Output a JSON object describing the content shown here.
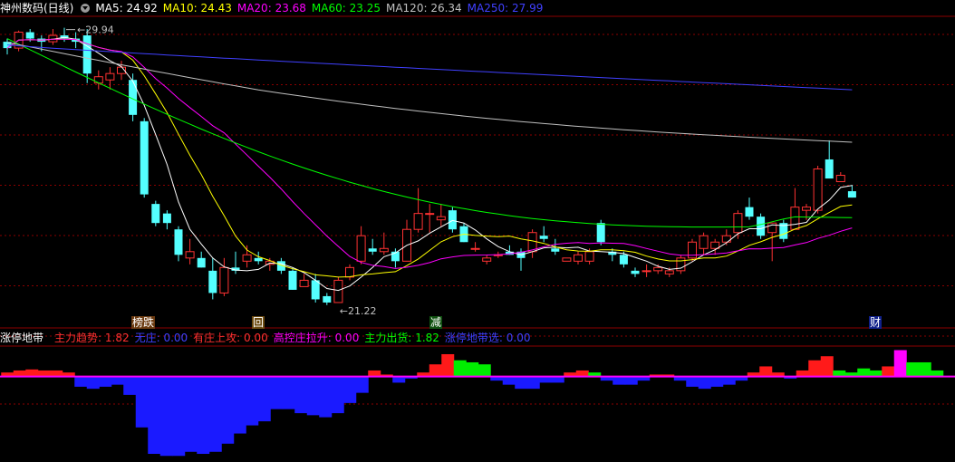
{
  "main_legend": {
    "title": "神州数码(日线)",
    "items": [
      {
        "label": "MA5: ",
        "value": "24.92",
        "color": "#ffffff"
      },
      {
        "label": "MA10: ",
        "value": "24.43",
        "color": "#ffff00"
      },
      {
        "label": "MA20: ",
        "value": "23.68",
        "color": "#ff00ff"
      },
      {
        "label": "MA60: ",
        "value": "23.25",
        "color": "#00ff00"
      },
      {
        "label": "MA120: ",
        "value": "26.34",
        "color": "#c0c0c0"
      },
      {
        "label": "MA250: ",
        "value": "27.99",
        "color": "#4040ff"
      }
    ]
  },
  "sub_legend": {
    "title": "涨停地带",
    "items": [
      {
        "label": "主力趋势: ",
        "value": "1.82",
        "color": "#ff3030"
      },
      {
        "label": "无庄: ",
        "value": "0.00",
        "color": "#4040ff"
      },
      {
        "label": "有庄上攻: ",
        "value": "0.00",
        "color": "#ff3030"
      },
      {
        "label": "高控庄拉升: ",
        "value": "0.00",
        "color": "#ff00ff"
      },
      {
        "label": "主力出货: ",
        "value": "1.82",
        "color": "#00ff00"
      },
      {
        "label": "涨停地带选: ",
        "value": "0.00",
        "color": "#4040ff"
      }
    ]
  },
  "annotations": {
    "high": "29.94",
    "low": "21.22",
    "markers": [
      {
        "text": "榜跌",
        "color": "#ffffff",
        "bg": "#6b3a10"
      },
      {
        "text": "回",
        "color": "#ffffff",
        "bg": "#6b4a10"
      },
      {
        "text": "减",
        "color": "#ffffff",
        "bg": "#105010"
      },
      {
        "text": "财",
        "color": "#ffffff",
        "bg": "#10208a"
      }
    ]
  },
  "colors": {
    "up": "#ff3232",
    "down": "#54ffff",
    "grid": "#8b0000"
  },
  "chart_data": [
    {
      "type": "candlestick",
      "ylim": [
        20.9,
        30.3
      ],
      "candles": [
        [
          29.5,
          29.6,
          29.1,
          29.3
        ],
        [
          29.3,
          29.85,
          29.2,
          29.8
        ],
        [
          29.8,
          29.9,
          29.5,
          29.6
        ],
        [
          29.6,
          29.7,
          29.2,
          29.5
        ],
        [
          29.5,
          29.9,
          29.4,
          29.7
        ],
        [
          29.7,
          29.94,
          29.5,
          29.6
        ],
        [
          29.6,
          29.8,
          29.3,
          29.5
        ],
        [
          29.7,
          29.9,
          28.2,
          28.5
        ],
        [
          28.2,
          28.6,
          28.0,
          28.4
        ],
        [
          28.3,
          28.7,
          28.0,
          28.5
        ],
        [
          28.5,
          28.9,
          28.3,
          28.7
        ],
        [
          28.3,
          28.5,
          27.0,
          27.2
        ],
        [
          27.0,
          27.1,
          24.6,
          24.7
        ],
        [
          24.4,
          24.5,
          23.7,
          23.8
        ],
        [
          24.1,
          24.2,
          23.6,
          23.8
        ],
        [
          23.6,
          23.7,
          22.6,
          22.8
        ],
        [
          22.7,
          23.3,
          22.5,
          22.9
        ],
        [
          22.7,
          22.9,
          22.4,
          22.4
        ],
        [
          22.3,
          22.7,
          21.4,
          21.6
        ],
        [
          21.6,
          22.7,
          21.5,
          22.4
        ],
        [
          22.4,
          22.9,
          22.2,
          22.3
        ],
        [
          22.6,
          23.1,
          22.4,
          22.8
        ],
        [
          22.7,
          22.9,
          22.5,
          22.6
        ],
        [
          22.5,
          22.7,
          22.3,
          22.6
        ],
        [
          22.6,
          22.7,
          22.2,
          22.3
        ],
        [
          22.3,
          22.4,
          21.7,
          21.7
        ],
        [
          21.8,
          22.2,
          21.8,
          22.0
        ],
        [
          22.0,
          22.2,
          21.3,
          21.4
        ],
        [
          21.5,
          21.6,
          21.22,
          21.3
        ],
        [
          21.3,
          22.1,
          21.3,
          22.0
        ],
        [
          22.1,
          22.5,
          22.0,
          22.4
        ],
        [
          22.6,
          23.7,
          22.5,
          23.4
        ],
        [
          23.0,
          23.3,
          22.8,
          22.9
        ],
        [
          22.9,
          23.5,
          22.8,
          23.0
        ],
        [
          22.9,
          23.0,
          22.4,
          22.6
        ],
        [
          22.6,
          23.9,
          22.6,
          23.6
        ],
        [
          23.6,
          24.9,
          23.5,
          24.1
        ],
        [
          24.1,
          24.4,
          23.5,
          24.1
        ],
        [
          23.9,
          24.4,
          23.7,
          24.0
        ],
        [
          24.2,
          24.3,
          23.5,
          23.6
        ],
        [
          23.7,
          23.8,
          23.2,
          23.2
        ],
        [
          23.0,
          23.2,
          22.9,
          23.0
        ],
        [
          22.6,
          22.8,
          22.5,
          22.7
        ],
        [
          22.8,
          22.9,
          22.7,
          22.8
        ],
        [
          22.9,
          23.1,
          22.8,
          22.8
        ],
        [
          22.9,
          23.0,
          22.3,
          22.7
        ],
        [
          22.9,
          23.6,
          22.7,
          23.5
        ],
        [
          23.4,
          23.7,
          23.2,
          23.3
        ],
        [
          23.0,
          23.3,
          22.8,
          22.9
        ],
        [
          22.6,
          22.7,
          22.6,
          22.7
        ],
        [
          22.6,
          22.9,
          22.5,
          22.8
        ],
        [
          22.6,
          23.0,
          22.5,
          22.9
        ],
        [
          23.8,
          23.9,
          23.1,
          23.2
        ],
        [
          22.9,
          23.0,
          22.6,
          22.8
        ],
        [
          22.8,
          22.9,
          22.4,
          22.5
        ],
        [
          22.3,
          22.4,
          22.1,
          22.2
        ],
        [
          22.3,
          22.5,
          22.1,
          22.3
        ],
        [
          22.3,
          22.5,
          22.2,
          22.4
        ],
        [
          22.2,
          22.4,
          22.1,
          22.3
        ],
        [
          22.3,
          22.8,
          22.2,
          22.7
        ],
        [
          22.7,
          23.3,
          22.6,
          23.2
        ],
        [
          23.0,
          23.5,
          22.8,
          23.4
        ],
        [
          23.0,
          23.3,
          22.8,
          23.2
        ],
        [
          23.2,
          23.6,
          23.1,
          23.4
        ],
        [
          23.5,
          24.2,
          23.3,
          24.1
        ],
        [
          24.3,
          24.6,
          23.9,
          24.0
        ],
        [
          24.0,
          24.1,
          23.3,
          23.4
        ],
        [
          23.5,
          23.8,
          22.6,
          23.8
        ],
        [
          23.8,
          23.9,
          23.2,
          23.3
        ],
        [
          23.6,
          24.9,
          23.6,
          24.3
        ],
        [
          24.2,
          24.4,
          23.9,
          24.3
        ],
        [
          24.2,
          25.6,
          24.1,
          25.5
        ],
        [
          25.8,
          26.4,
          25.3,
          25.2
        ],
        [
          25.1,
          25.4,
          25.1,
          25.3
        ],
        [
          24.8,
          25.0,
          24.6,
          24.6
        ]
      ]
    },
    {
      "type": "bar",
      "ylim": [
        -4.2,
        1.5
      ],
      "bars": [
        [
          0.2,
          "r"
        ],
        [
          0.3,
          "r"
        ],
        [
          0.35,
          "r"
        ],
        [
          0.3,
          "r"
        ],
        [
          0.3,
          "r"
        ],
        [
          0.2,
          "r"
        ],
        [
          -0.5,
          "b"
        ],
        [
          -0.6,
          "b"
        ],
        [
          -0.5,
          "b"
        ],
        [
          -0.4,
          "b"
        ],
        [
          -0.9,
          "b"
        ],
        [
          -2.5,
          "b"
        ],
        [
          -3.8,
          "b"
        ],
        [
          -3.9,
          "b"
        ],
        [
          -3.9,
          "b"
        ],
        [
          -3.7,
          "b"
        ],
        [
          -3.8,
          "b"
        ],
        [
          -3.7,
          "b"
        ],
        [
          -3.3,
          "b"
        ],
        [
          -2.8,
          "b"
        ],
        [
          -2.4,
          "b"
        ],
        [
          -2.2,
          "b"
        ],
        [
          -1.6,
          "b"
        ],
        [
          -1.6,
          "b"
        ],
        [
          -1.8,
          "b"
        ],
        [
          -1.9,
          "b"
        ],
        [
          -2.0,
          "b"
        ],
        [
          -1.8,
          "b"
        ],
        [
          -1.3,
          "b"
        ],
        [
          -0.8,
          "b"
        ],
        [
          0.3,
          "r"
        ],
        [
          0.1,
          "r"
        ],
        [
          -0.3,
          "b"
        ],
        [
          -0.1,
          "b"
        ],
        [
          0.2,
          "r"
        ],
        [
          0.6,
          "r"
        ],
        [
          1.1,
          "r"
        ],
        [
          0.8,
          "g"
        ],
        [
          0.7,
          "g"
        ],
        [
          0.6,
          "g"
        ],
        [
          -0.2,
          "b"
        ],
        [
          -0.4,
          "b"
        ],
        [
          -0.6,
          "b"
        ],
        [
          -0.6,
          "b"
        ],
        [
          -0.3,
          "b"
        ],
        [
          -0.3,
          "b"
        ],
        [
          0.2,
          "r"
        ],
        [
          0.3,
          "r"
        ],
        [
          0.2,
          "g"
        ],
        [
          -0.2,
          "b"
        ],
        [
          -0.4,
          "b"
        ],
        [
          -0.4,
          "b"
        ],
        [
          -0.2,
          "b"
        ],
        [
          0.1,
          "r"
        ],
        [
          0.1,
          "r"
        ],
        [
          -0.2,
          "b"
        ],
        [
          -0.5,
          "b"
        ],
        [
          -0.6,
          "b"
        ],
        [
          -0.5,
          "b"
        ],
        [
          -0.4,
          "b"
        ],
        [
          -0.2,
          "b"
        ],
        [
          0.2,
          "r"
        ],
        [
          0.5,
          "r"
        ],
        [
          0.2,
          "r"
        ],
        [
          -0.1,
          "b"
        ],
        [
          0.3,
          "r"
        ],
        [
          0.8,
          "r"
        ],
        [
          1.0,
          "r"
        ],
        [
          0.3,
          "g"
        ],
        [
          0.2,
          "g"
        ],
        [
          0.4,
          "g"
        ],
        [
          0.3,
          "g"
        ],
        [
          0.5,
          "r"
        ],
        [
          1.3,
          "m"
        ],
        [
          0.7,
          "g"
        ],
        [
          0.7,
          "g"
        ],
        [
          0.3,
          "g"
        ]
      ]
    }
  ]
}
